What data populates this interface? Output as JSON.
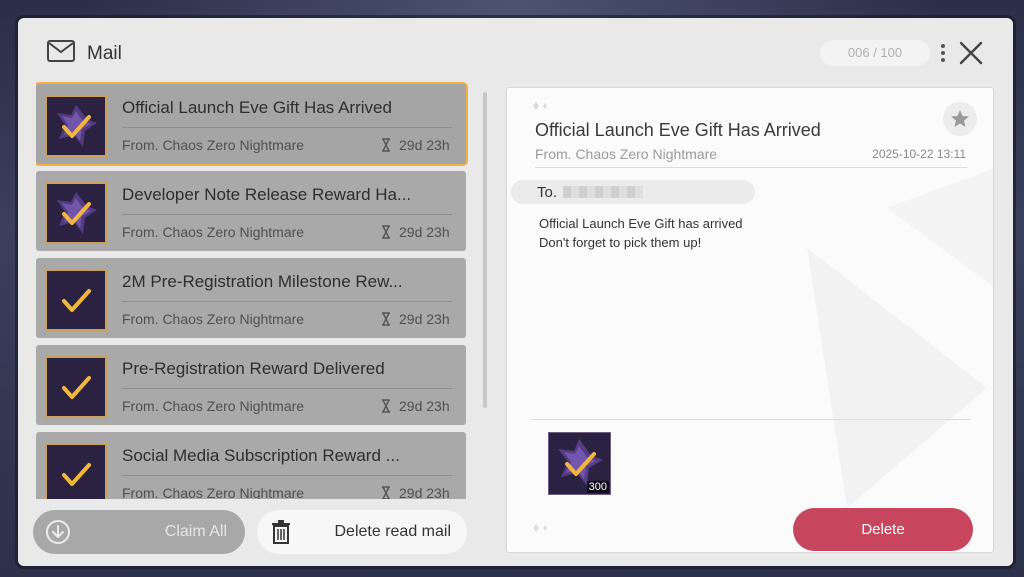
{
  "header": {
    "title": "Mail",
    "counter": "006 / 100",
    "icons": {
      "mail": "mail-icon",
      "more": "more-icon",
      "close": "close-icon"
    }
  },
  "mail_list": [
    {
      "title": "Official Launch Eve Gift Has Arrived",
      "from": "From. Chaos Zero Nightmare",
      "time": "29d 23h",
      "selected": true
    },
    {
      "title": "Developer Note Release Reward Ha...",
      "from": "From. Chaos Zero Nightmare",
      "time": "29d 23h",
      "selected": false
    },
    {
      "title": "2M Pre-Registration Milestone Rew...",
      "from": "From. Chaos Zero Nightmare",
      "time": "29d 23h",
      "selected": false
    },
    {
      "title": "Pre-Registration Reward Delivered",
      "from": "From. Chaos Zero Nightmare",
      "time": "29d 23h",
      "selected": false
    },
    {
      "title": "Social Media Subscription Reward ...",
      "from": "From. Chaos Zero Nightmare",
      "time": "29d 23h",
      "selected": false
    }
  ],
  "footer": {
    "claim_all": "Claim All",
    "delete_read": "Delete read mail"
  },
  "detail": {
    "title": "Official Launch Eve Gift Has Arrived",
    "from": "From. Chaos Zero Nightmare",
    "date": "2025-10-22 13:11",
    "to_label": "To.",
    "body_line1": "Official Launch Eve Gift has arrived",
    "body_line2": "Don't forget to pick them up!",
    "reward_qty": "300",
    "delete": "Delete"
  },
  "colors": {
    "accent_delete": "#c7465e",
    "selected_border": "#f0b14a",
    "item_bg": "#a9a9aa"
  }
}
